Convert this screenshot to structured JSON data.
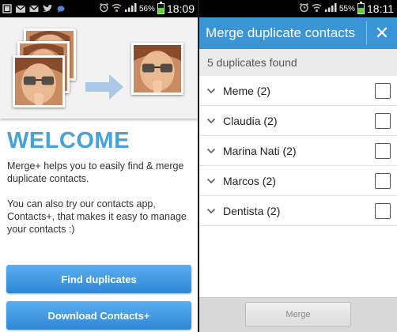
{
  "colors": {
    "accent_blue": "#3a95d6",
    "welcome_blue": "#45a3dc",
    "battery_green": "#5fd13a"
  },
  "left_screen": {
    "status": {
      "battery_pct": "56%",
      "time": "18:09",
      "battery_level": 0.56
    },
    "welcome_title": "WELCOME",
    "description_1": "Merge+ helps you to easily find & merge duplicate contacts.",
    "description_2": "You can also try our contacts app, Contacts+, that makes it easy to manage your contacts :)",
    "find_button": "Find duplicates",
    "download_button": "Download Contacts+"
  },
  "right_screen": {
    "status": {
      "battery_pct": "55%",
      "time": "18:11",
      "battery_level": 0.55
    },
    "title": "Merge duplicate contacts",
    "subheader": "5 duplicates found",
    "contacts": [
      {
        "name": "Meme (2)"
      },
      {
        "name": "Claudia (2)"
      },
      {
        "name": "Marina Nati (2)"
      },
      {
        "name": "Marcos (2)"
      },
      {
        "name": "Dentista (2)"
      }
    ],
    "merge_button": "Merge"
  }
}
